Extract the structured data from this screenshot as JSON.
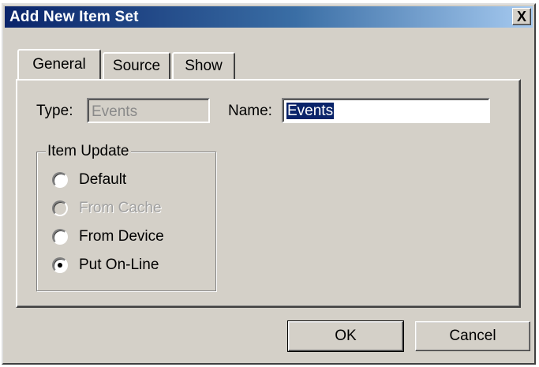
{
  "window": {
    "title": "Add New Item Set",
    "close_glyph": "X"
  },
  "tabs": [
    {
      "label": "General",
      "active": true
    },
    {
      "label": "Source",
      "active": false
    },
    {
      "label": "Show",
      "active": false
    }
  ],
  "general": {
    "type_label": "Type:",
    "type_value": "Events",
    "name_label": "Name:",
    "name_value": "Events"
  },
  "item_update": {
    "caption": "Item Update",
    "options": [
      {
        "label": "Default",
        "selected": false,
        "enabled": true
      },
      {
        "label": "From Cache",
        "selected": false,
        "enabled": false
      },
      {
        "label": "From Device",
        "selected": false,
        "enabled": true
      },
      {
        "label": "Put On-Line",
        "selected": true,
        "enabled": true
      }
    ]
  },
  "buttons": {
    "ok": "OK",
    "cancel": "Cancel"
  },
  "colors": {
    "dialog_face": "#d4d0c8",
    "title_start": "#0a246a",
    "title_end": "#a6caf0",
    "selection": "#0a246a",
    "disabled_text": "#a0a0a0"
  }
}
